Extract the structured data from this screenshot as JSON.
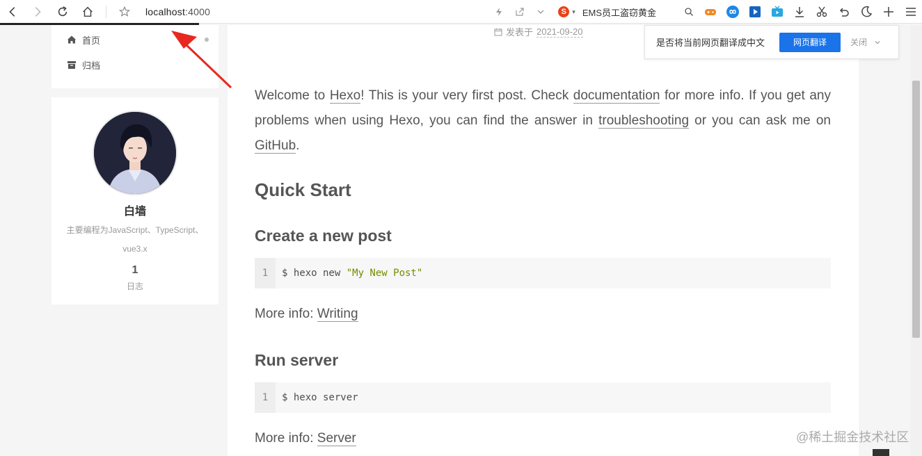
{
  "browser": {
    "url_host": "localhost",
    "url_port": ":4000",
    "search_engine_label": "EMS员工盗窃黄金",
    "search_engine_logo": "S"
  },
  "sidebar": {
    "menu": [
      {
        "label": "首页",
        "icon": "home-icon"
      },
      {
        "label": "归档",
        "icon": "archive-icon"
      }
    ],
    "profile": {
      "name": "白墙",
      "description_line1": "主要编程为JavaScript、TypeScript、",
      "description_line2": "vue3.x",
      "post_count": "1",
      "post_count_label": "日志"
    }
  },
  "post": {
    "meta_label": "发表于",
    "meta_date": "2021-09-20",
    "intro": {
      "t1": "Welcome to ",
      "l1": "Hexo",
      "t2": "! This is your very first post. Check ",
      "l2": "documentation",
      "t3": " for more info. If you get any problems when using Hexo, you can find the answer in ",
      "l3": "troubleshooting",
      "t4": " or you can ask me on ",
      "l4": "GitHub",
      "t5": "."
    },
    "quick_start": "Quick Start",
    "sections": [
      {
        "heading": "Create a new post",
        "code_line_number": "1",
        "code_prefix": "$ hexo new ",
        "code_string": "\"My New Post\"",
        "more_label": "More info: ",
        "more_link": "Writing"
      },
      {
        "heading": "Run server",
        "code_line_number": "1",
        "code_prefix": "$ hexo server",
        "code_string": "",
        "more_label": "More info: ",
        "more_link": "Server"
      }
    ]
  },
  "translate_bar": {
    "question": "是否将当前网页翻译成中文",
    "translate_button": "网页翻译",
    "close_button": "关闭"
  },
  "watermark": "@稀土掘金技术社区",
  "colors": {
    "accent_blue": "#1a73e8",
    "arrow_red": "#e8281f",
    "progress_bar": "#222222",
    "code_string": "#718c00"
  }
}
